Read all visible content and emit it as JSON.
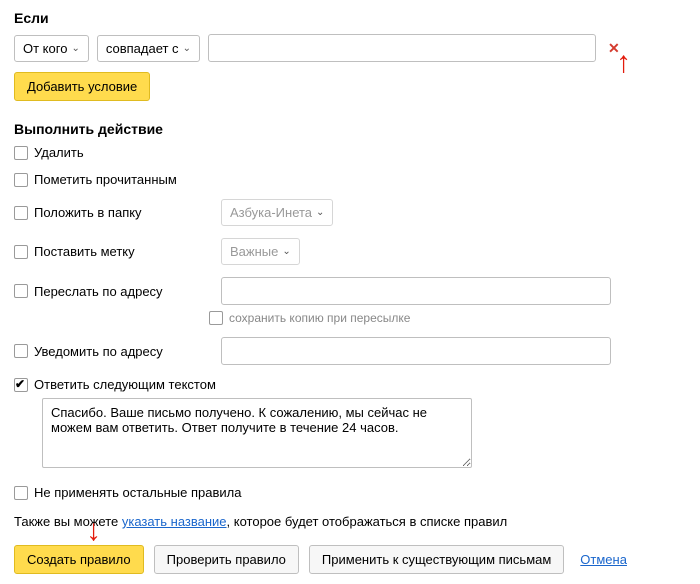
{
  "condition": {
    "title": "Если",
    "from_label": "От кого",
    "match_label": "совпадает с",
    "value": "",
    "add_condition": "Добавить условие"
  },
  "actions": {
    "title": "Выполнить действие",
    "delete": "Удалить",
    "mark_read": "Пометить прочитанным",
    "move_to_folder": "Положить в папку",
    "folder_value": "Азбука-Инета",
    "set_label": "Поставить метку",
    "label_value": "Важные",
    "forward_to": "Переслать по адресу",
    "save_copy": "сохранить копию при пересылке",
    "notify_to": "Уведомить по адресу",
    "reply_with": "Ответить следующим текстом",
    "reply_text": "Спасибо. Ваше письмо получено. К сожалению, мы сейчас не можем вам ответить. Ответ получите в течение 24 часов.",
    "no_other_rules": "Не применять остальные правила"
  },
  "note": {
    "prefix": "Также вы можете ",
    "link": "указать название",
    "suffix": ", которое будет отображаться в списке правил"
  },
  "buttons": {
    "create": "Создать правило",
    "check": "Проверить правило",
    "apply_existing": "Применить к существующим письмам",
    "cancel": "Отмена"
  }
}
